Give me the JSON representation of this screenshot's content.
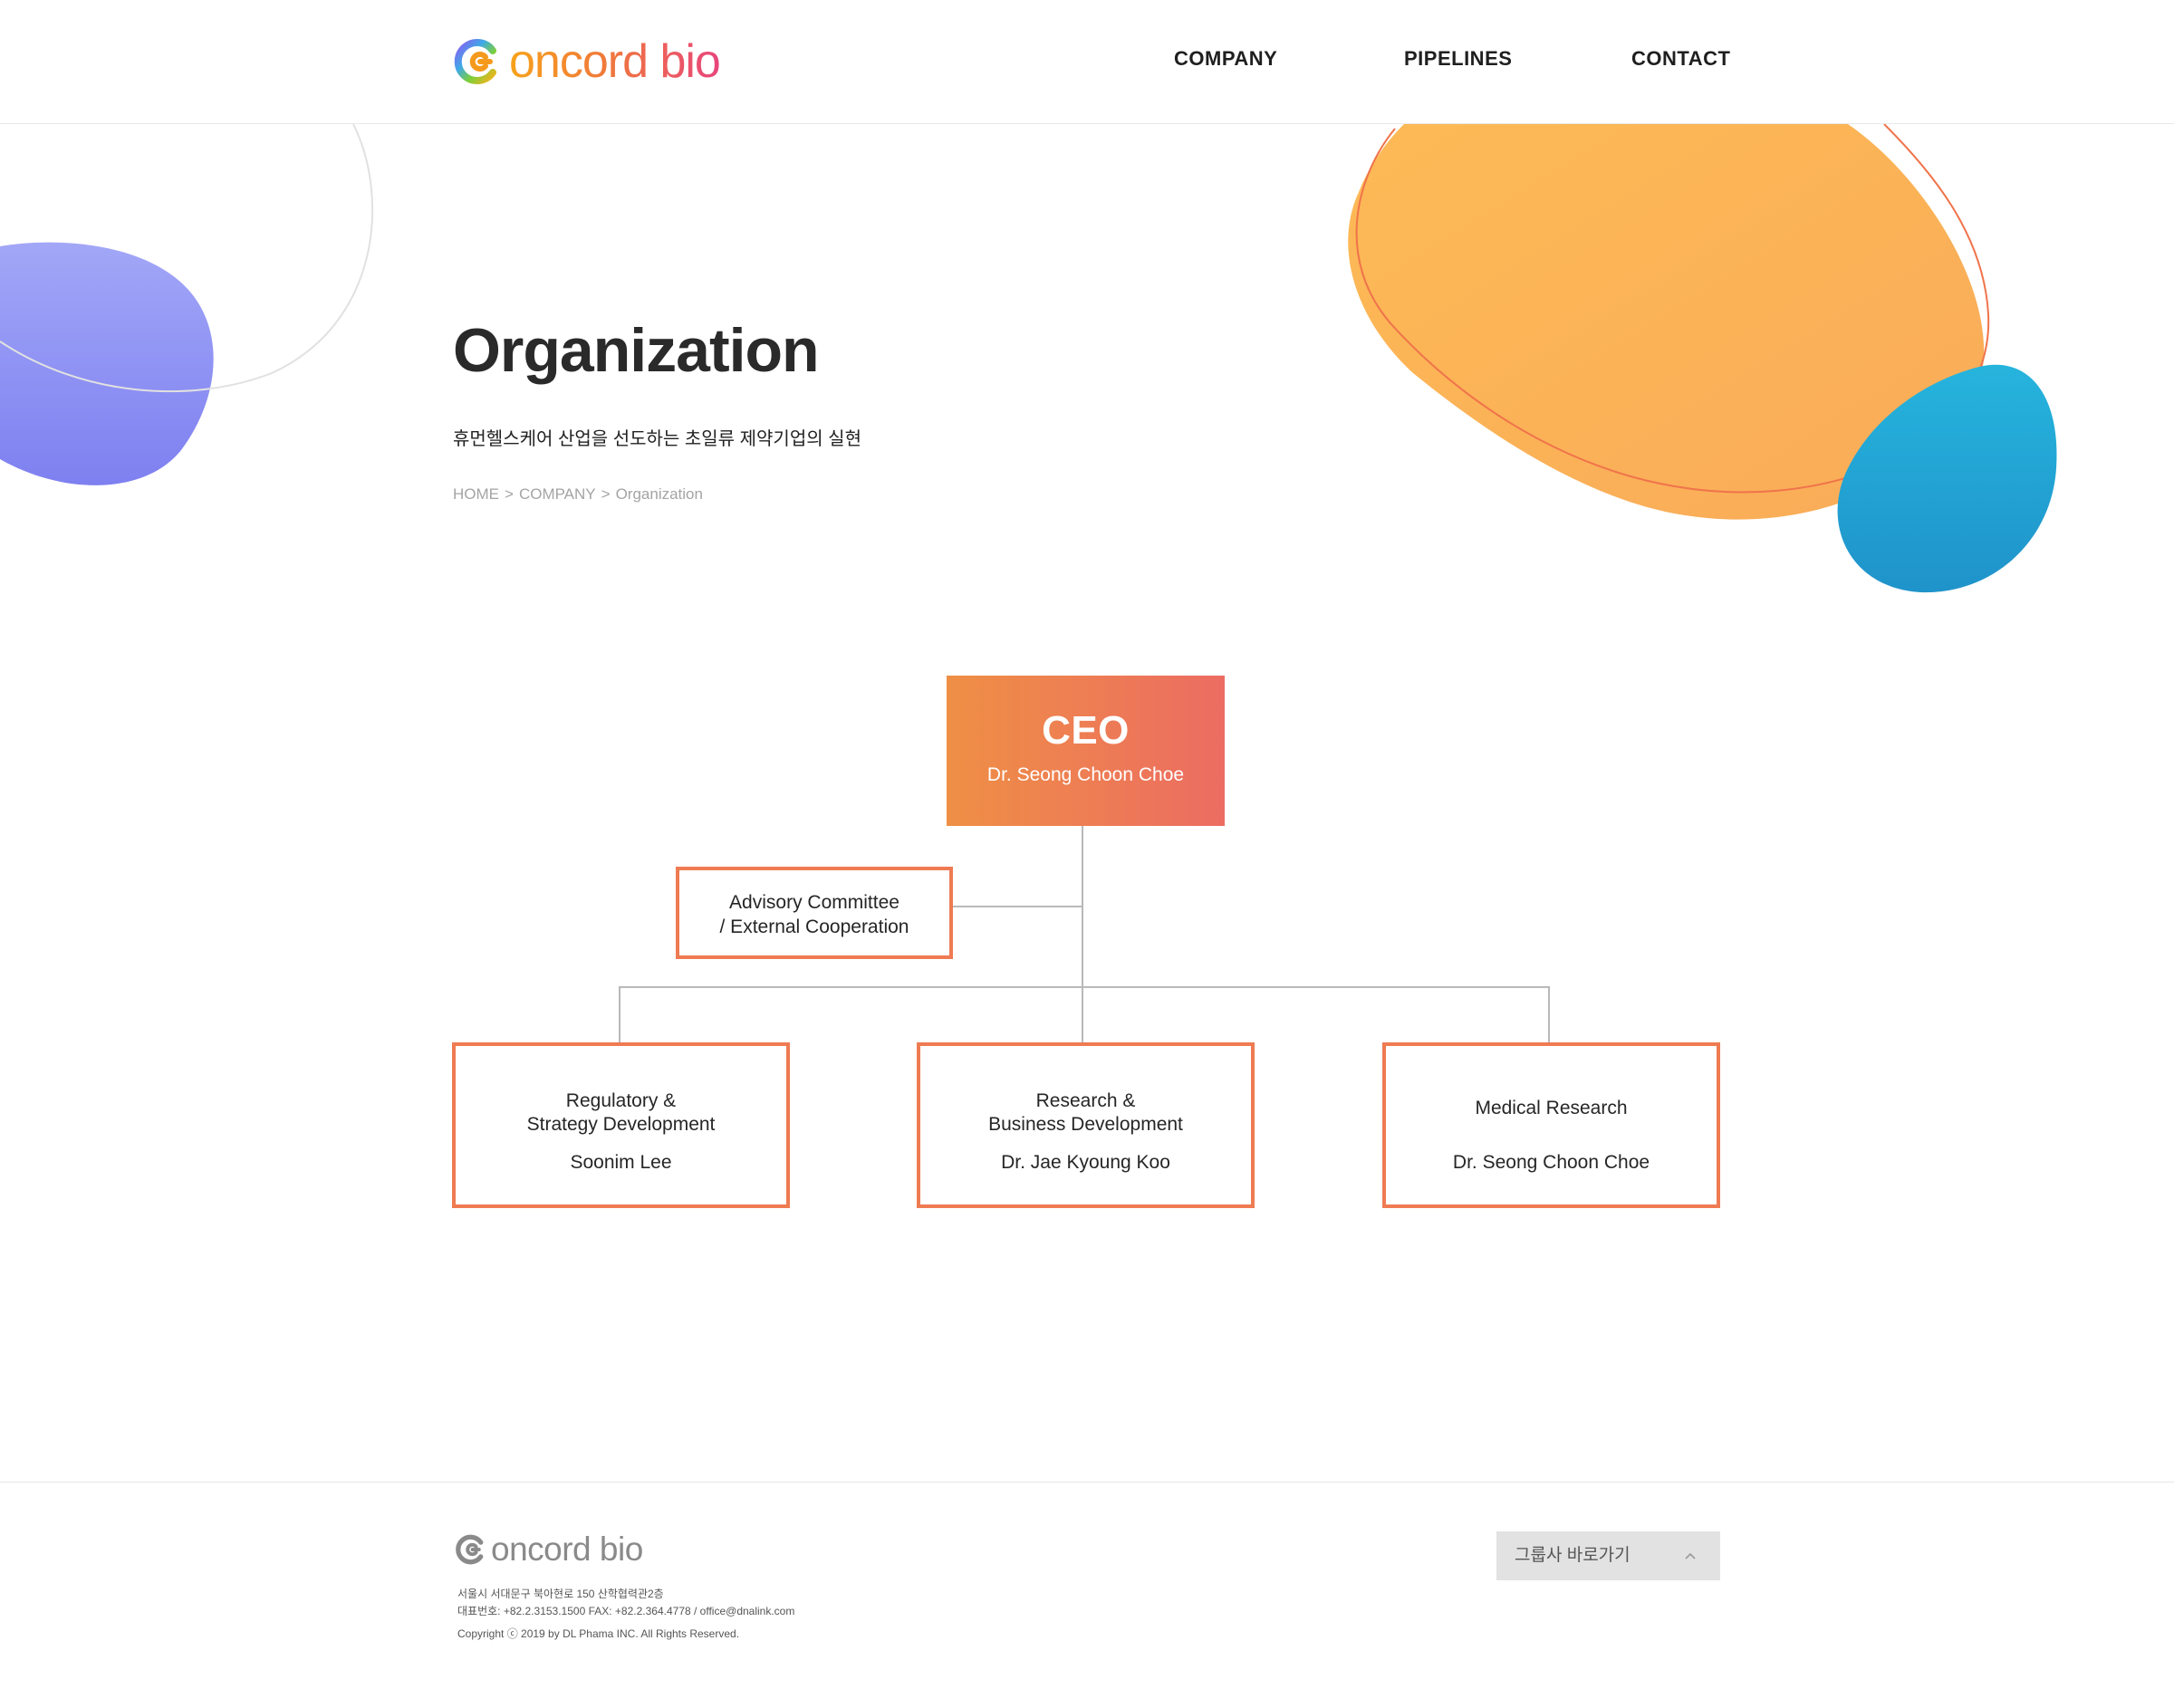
{
  "header": {
    "logo_text": "oncord bio",
    "nav": [
      "COMPANY",
      "PIPELINES",
      "CONTACT"
    ]
  },
  "hero": {
    "title": "Organization",
    "subtitle": "휴먼헬스케어 산업을 선도하는 초일류 제약기업의 실현",
    "breadcrumb": [
      "HOME",
      "COMPANY",
      "Organization"
    ],
    "breadcrumb_separator": ">"
  },
  "org": {
    "ceo": {
      "title": "CEO",
      "name": "Dr. Seong Choon Choe"
    },
    "advisory": {
      "line1": "Advisory Committee",
      "line2": "/ External Cooperation"
    },
    "departments": [
      {
        "line1": "Regulatory  &",
        "line2": "Strategy Development",
        "head": "Soonim Lee"
      },
      {
        "line1": "Research &",
        "line2": "Business Development",
        "head": "Dr. Jae Kyoung Koo"
      },
      {
        "line1": "Medical Research",
        "line2": "",
        "head": "Dr. Seong Choon Choe"
      }
    ]
  },
  "footer": {
    "logo_text": "oncord bio",
    "address": "서울시 서대문구 북아현로 150 산학협력관2층",
    "contact": "대표번호: +82.2.3153.1500   FAX: +82.2.364.4778 / office@dnalink.com",
    "copyright": "Copyright ⓒ 2019 by DL Phama INC. All Rights Reserved.",
    "family_select": "그룹사 바로가기"
  },
  "colors": {
    "accent_orange": "#ef7b52",
    "ceo_gradient": [
      "#ef8f45",
      "#ec6c62"
    ],
    "blob_orange": "#fbb457",
    "blob_blue": "#22a9d6",
    "blob_purple": "#8b8ef5"
  },
  "icons": [
    "oncord-logo-icon",
    "chevron-up-icon"
  ]
}
